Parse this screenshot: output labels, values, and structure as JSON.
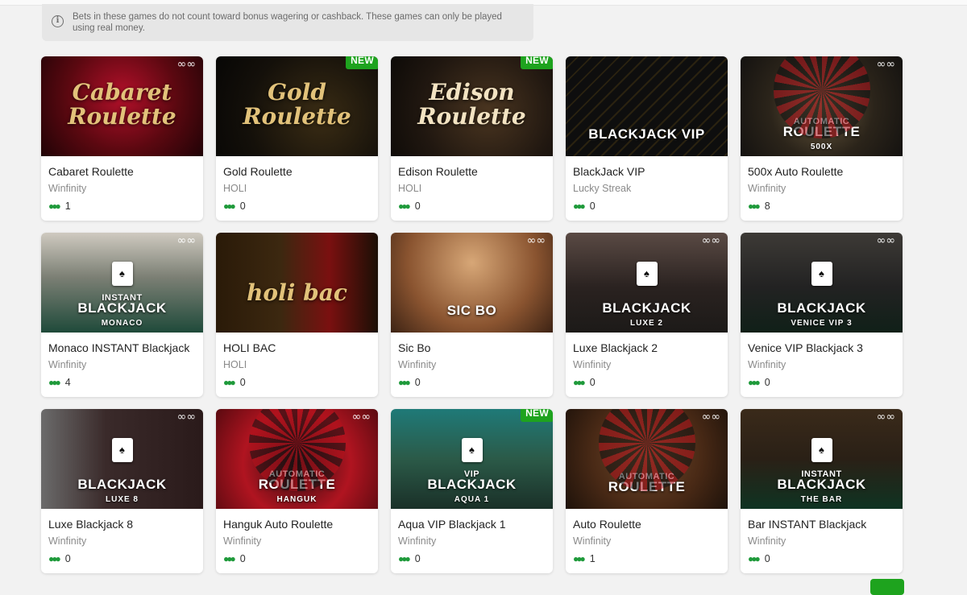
{
  "notice": {
    "icon": "info-icon",
    "text": "Bets in these games do not count toward bonus wagering or cashback. These games can only be played using real money."
  },
  "badge_new": "NEW",
  "games": [
    {
      "name": "Cabaret Roulette",
      "provider": "Winfinity",
      "players": "1",
      "is_new": false,
      "thumb": {
        "style": "t-cabaret",
        "kind": "script",
        "script": "Cabaret Roulette",
        "color": "gold-text"
      }
    },
    {
      "name": "Gold Roulette",
      "provider": "HOLI",
      "players": "0",
      "is_new": true,
      "thumb": {
        "style": "t-gold",
        "kind": "script",
        "script": "Gold Roulette",
        "color": "gold-text"
      }
    },
    {
      "name": "Edison Roulette",
      "provider": "HOLI",
      "players": "0",
      "is_new": true,
      "thumb": {
        "style": "t-edison",
        "kind": "script",
        "script": "Edison Roulette",
        "color": "cream-text"
      }
    },
    {
      "name": "BlackJack VIP",
      "provider": "Lucky Streak",
      "players": "0",
      "is_new": false,
      "thumb": {
        "style": "t-bjvip",
        "kind": "big",
        "big": "BLACKJACK VIP",
        "color": "yellow-text"
      }
    },
    {
      "name": "500x Auto Roulette",
      "provider": "Winfinity",
      "players": "8",
      "is_new": false,
      "thumb": {
        "style": "t-500x",
        "kind": "big",
        "pre": "AUTOMATIC",
        "big": "ROULETTE",
        "small": "500X",
        "wheel": true
      }
    },
    {
      "name": "Monaco INSTANT Blackjack",
      "provider": "Winfinity",
      "players": "4",
      "is_new": false,
      "thumb": {
        "style": "t-monaco",
        "kind": "big",
        "pre": "INSTANT",
        "big": "BLACKJACK",
        "small": "MONACO",
        "card": true
      }
    },
    {
      "name": "HOLI BAC",
      "provider": "HOLI",
      "players": "0",
      "is_new": false,
      "thumb": {
        "style": "t-holibac",
        "kind": "script",
        "script": "holi bac",
        "color": "gold-text"
      }
    },
    {
      "name": "Sic Bo",
      "provider": "Winfinity",
      "players": "0",
      "is_new": false,
      "thumb": {
        "style": "t-sicbo",
        "kind": "big",
        "big": "SIC BO"
      }
    },
    {
      "name": "Luxe Blackjack 2",
      "provider": "Winfinity",
      "players": "0",
      "is_new": false,
      "thumb": {
        "style": "t-luxe2",
        "kind": "big",
        "big": "BLACKJACK",
        "small": "LUXE 2",
        "card": true
      }
    },
    {
      "name": "Venice VIP Blackjack 3",
      "provider": "Winfinity",
      "players": "0",
      "is_new": false,
      "thumb": {
        "style": "t-venice",
        "kind": "big",
        "big": "BLACKJACK",
        "small": "VENICE VIP 3",
        "card": true
      }
    },
    {
      "name": "Luxe Blackjack 8",
      "provider": "Winfinity",
      "players": "0",
      "is_new": false,
      "thumb": {
        "style": "t-luxe8",
        "kind": "big",
        "big": "BLACKJACK",
        "small": "LUXE 8",
        "card": true
      }
    },
    {
      "name": "Hanguk Auto Roulette",
      "provider": "Winfinity",
      "players": "0",
      "is_new": false,
      "thumb": {
        "style": "t-hanguk",
        "kind": "big",
        "pre": "AUTOMATIC",
        "big": "ROULETTE",
        "small": "HANGUK",
        "wheel": true
      }
    },
    {
      "name": "Aqua VIP Blackjack 1",
      "provider": "Winfinity",
      "players": "0",
      "is_new": true,
      "thumb": {
        "style": "t-aqua",
        "kind": "big",
        "pre": "VIP",
        "big": "BLACKJACK",
        "small": "AQUA 1",
        "card": true
      }
    },
    {
      "name": "Auto Roulette",
      "provider": "Winfinity",
      "players": "1",
      "is_new": false,
      "thumb": {
        "style": "t-auto",
        "kind": "big",
        "pre": "AUTOMATIC",
        "big": "ROULETTE",
        "wheel": true
      }
    },
    {
      "name": "Bar INSTANT Blackjack",
      "provider": "Winfinity",
      "players": "0",
      "is_new": false,
      "thumb": {
        "style": "t-bar",
        "kind": "big",
        "pre": "INSTANT",
        "big": "BLACKJACK",
        "small": "THE BAR",
        "card": true
      }
    }
  ],
  "icons": {
    "players": "users-icon",
    "provider_logo": "infinity-icon"
  }
}
